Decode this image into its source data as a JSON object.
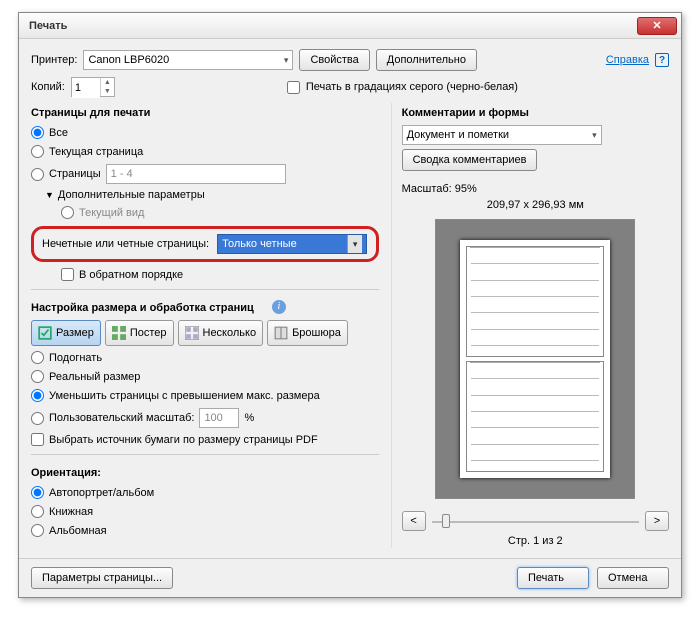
{
  "dialog": {
    "title": "Печать"
  },
  "help": {
    "label": "Справка"
  },
  "printer": {
    "label": "Принтер:",
    "value": "Canon LBP6020",
    "properties_btn": "Свойства",
    "advanced_btn": "Дополнительно"
  },
  "copies": {
    "label": "Копий:",
    "value": "1"
  },
  "grayscale": {
    "label": "Печать в градациях серого (черно-белая)"
  },
  "pages": {
    "title": "Страницы для печати",
    "all": "Все",
    "current": "Текущая страница",
    "range_label": "Страницы",
    "range_value": "1 - 4",
    "more": "Дополнительные параметры",
    "current_view": "Текущий вид",
    "odd_even_label": "Нечетные или четные страницы:",
    "odd_even_value": "Только четные",
    "reverse": "В обратном порядке"
  },
  "sizing": {
    "title": "Настройка размера и обработка страниц",
    "tabs": {
      "size": "Размер",
      "poster": "Постер",
      "multiple": "Несколько",
      "booklet": "Брошюра"
    },
    "fit": "Подогнать",
    "actual": "Реальный размер",
    "shrink": "Уменьшить страницы с превышением макс. размера",
    "custom": "Пользовательский масштаб:",
    "custom_value": "100",
    "pct": "%",
    "source": "Выбрать источник бумаги по размеру страницы PDF"
  },
  "orientation": {
    "title": "Ориентация:",
    "auto": "Автопортрет/альбом",
    "portrait": "Книжная",
    "landscape": "Альбомная"
  },
  "comments": {
    "title": "Комментарии и формы",
    "value": "Документ и пометки",
    "summary_btn": "Сводка комментариев"
  },
  "preview": {
    "scale_label": "Масштаб:  95%",
    "dims": "209,97 x 296,93 мм",
    "page_of": "Стр. 1 из 2"
  },
  "footer": {
    "page_setup": "Параметры страницы...",
    "print": "Печать",
    "cancel": "Отмена"
  }
}
